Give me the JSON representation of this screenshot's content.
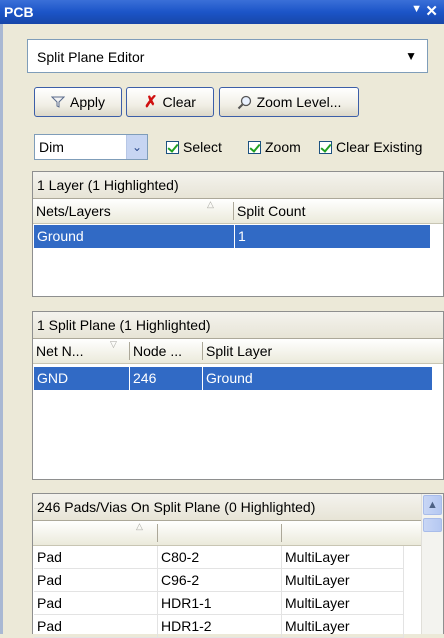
{
  "window": {
    "title": "PCB"
  },
  "editor_selector": {
    "value": "Split Plane Editor"
  },
  "toolbar": {
    "apply_label": "Apply",
    "clear_label": "Clear",
    "zoom_label": "Zoom Level..."
  },
  "mask_mode": {
    "value": "Dim"
  },
  "options": {
    "select_label": "Select",
    "zoom_label": "Zoom",
    "clear_existing_label": "Clear Existing"
  },
  "layers": {
    "title": "1 Layer (1 Highlighted)",
    "columns": [
      "Nets/Layers",
      "Split Count"
    ],
    "rows": [
      {
        "name": "Ground",
        "count": "1",
        "selected": true
      }
    ]
  },
  "split_planes": {
    "title": "1 Split Plane (1 Highlighted)",
    "columns": [
      "Net N...",
      "Node ...",
      "Split Layer"
    ],
    "rows": [
      {
        "net": "GND",
        "nodes": "246",
        "layer": "Ground",
        "selected": true
      }
    ]
  },
  "pads": {
    "title": "246 Pads/Vias On Split Plane (0 Highlighted)",
    "rows": [
      {
        "type": "Pad",
        "designator": "C80-2",
        "layer": "MultiLayer"
      },
      {
        "type": "Pad",
        "designator": "C96-2",
        "layer": "MultiLayer"
      },
      {
        "type": "Pad",
        "designator": "HDR1-1",
        "layer": "MultiLayer"
      },
      {
        "type": "Pad",
        "designator": "HDR1-2",
        "layer": "MultiLayer"
      }
    ]
  },
  "colors": {
    "title_bar": "#1C55C8",
    "selection": "#316AC5",
    "checkmark": "#21A121"
  }
}
